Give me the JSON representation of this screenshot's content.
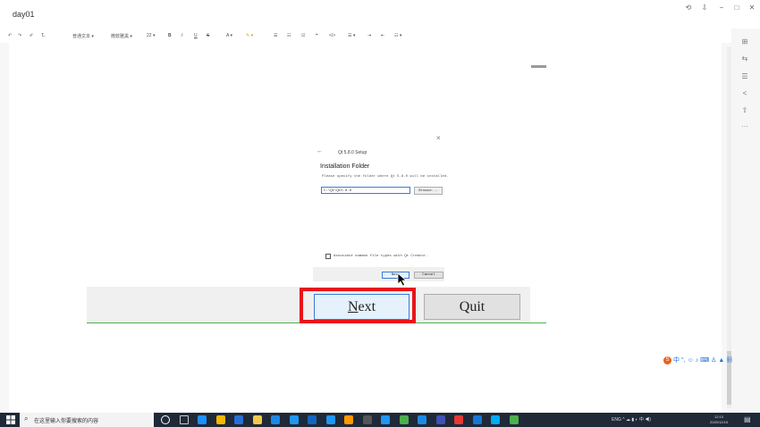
{
  "window": {
    "title": "day01",
    "controls": {
      "sync": "⟲",
      "pin": "⇩",
      "minimize": "−",
      "maximize": "□",
      "close": "✕"
    }
  },
  "toolbar": {
    "undo": "↶",
    "redo": "↷",
    "format_painter": "✐",
    "clear_format": "T̶",
    "paragraph_style": "普通文本 ▾",
    "font_family": "微软雅黑 ▾",
    "font_size": "22 ▾",
    "bold": "B",
    "italic": "I",
    "underline": "U",
    "strikethrough": "S",
    "font_color": "A ▾",
    "highlight": "✎ ▾",
    "ordered_list": "☰",
    "unordered_list": "☷",
    "checklist": "☑",
    "quote": "❝",
    "code": "</>",
    "align": "☰ ▾",
    "indent": "⇥",
    "outdent": "⇤",
    "insert": "☷ ▾"
  },
  "right_rail": [
    "⊞",
    "⇆",
    "☰",
    "<",
    "⇧",
    "···"
  ],
  "dialog": {
    "close": "×",
    "back": "←",
    "setup_title": "Qt 5.8.0 Setup",
    "heading": "Installation Folder",
    "description": "Please specify the folder where Qt 5.8.0 will be installed.",
    "path_value": "C:\\Qt\\Qt5.8.0",
    "browse": "Browse...",
    "checkbox_label": "Associate common file types with Qt Creator.",
    "next_small": "Next",
    "cancel_small": "Cancel"
  },
  "zoom": {
    "next_first": "N",
    "next_rest": "ext",
    "quit": "Quit"
  },
  "ime": {
    "logo": "S",
    "items": "中 °, ☺ ♪ ⌨ ♙ ▲ ▦"
  },
  "taskbar": {
    "search_placeholder": "在这里输入你要搜索的内容",
    "tray": "ENG ^ ☁ ▮ ◐ 中 ◀)",
    "clock_time": "12:10",
    "clock_date": "2020/12/15",
    "notification": "▤",
    "icon_colors": [
      "#ffffff",
      "#cccccc",
      "#1e90ff",
      "#f5b700",
      "#2a6fd6",
      "#f2c94c",
      "#1e88e5",
      "#2196f3",
      "#1565c0",
      "#2196f3",
      "#ff9800",
      "#555555",
      "#2196f3",
      "#4caf50",
      "#1e88e5",
      "#3f51b5",
      "#e53935",
      "#1976d2",
      "#03a9f4",
      "#4caf50"
    ]
  }
}
